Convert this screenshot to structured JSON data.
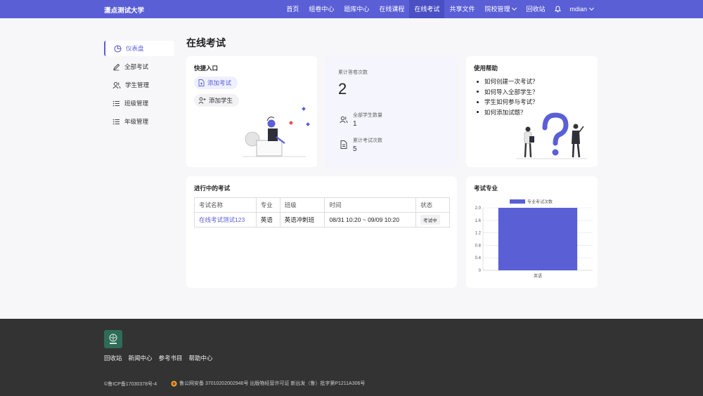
{
  "header": {
    "brand": "潇点测试大学",
    "nav": [
      "首页",
      "组卷中心",
      "题库中心",
      "在线课程",
      "在线考试",
      "共享文件",
      "院校管理",
      "回收站"
    ],
    "active_nav": "在线考试",
    "user": "mdian"
  },
  "sidebar": {
    "items": [
      {
        "label": "仪表盘",
        "icon": "pie-chart-icon",
        "active": true
      },
      {
        "label": "全部考试",
        "icon": "pencil-icon"
      },
      {
        "label": "学生管理",
        "icon": "users-icon"
      },
      {
        "label": "班级管理",
        "icon": "list-icon"
      },
      {
        "label": "年级管理",
        "icon": "list-icon"
      }
    ]
  },
  "page_title": "在线考试",
  "quick": {
    "title": "快捷入口",
    "add_exam": "添加考试",
    "add_student": "添加学生"
  },
  "stats": {
    "total_answers_label": "累计答卷次数",
    "total_answers": "2",
    "students_label": "全部学生数量",
    "students": "1",
    "exams_label": "累计考试次数",
    "exams": "5"
  },
  "help": {
    "title": "使用帮助",
    "items": [
      "如何创建一次考试？",
      "如何导入全部学生？",
      "学生如何参与考试？",
      "如何添加试题？"
    ]
  },
  "ongoing": {
    "title": "进行中的考试",
    "columns": [
      "考试名称",
      "专业",
      "班级",
      "时间",
      "状态"
    ],
    "rows": [
      {
        "name": "在线考试测试123",
        "major": "英语",
        "class": "英语冲刺班",
        "time": "08/31 10:20 ~ 09/09 10:20",
        "status": "考试中"
      }
    ]
  },
  "major_chart": {
    "title": "考试专业",
    "accent": "#5a5fd6"
  },
  "chart_data": {
    "type": "bar",
    "categories": [
      "英语"
    ],
    "series": [
      {
        "name": "专业考试次数",
        "values": [
          2
        ]
      }
    ],
    "yticks": [
      "0",
      "0.4",
      "0.8",
      "1.2",
      "1.6",
      "2.0"
    ],
    "ylim": [
      0,
      2
    ],
    "legend": "top",
    "grid": true
  },
  "footer": {
    "links": [
      "回收站",
      "新闻中心",
      "参考书目",
      "帮助中心"
    ],
    "icp": "©鲁ICP备17030378号-4",
    "police": "鲁公网安备 37010202002946号 出版物经营许可证 新出发（鲁）批字第P1211A306号"
  }
}
